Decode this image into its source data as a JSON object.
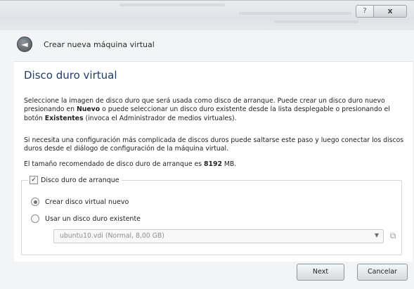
{
  "window": {
    "help_glyph": "?",
    "close_glyph": "x"
  },
  "header": {
    "back_glyph": "◄",
    "title": "Crear nueva máquina virtual"
  },
  "main": {
    "section_title": "Disco duro virtual",
    "p1": {
      "a": "Seleccione la imagen de disco duro que será usada como disco de arranque. Puede crear un disco duro nuevo presionando en ",
      "b1": "Nuevo",
      "c": " o puede seleccionar un disco duro existente desde la lista desplegable o presionando el botón ",
      "b2": "Existentes",
      "d": " (invoca el Administrador de medios virtuales)."
    },
    "p2": "Si necesita una configuración más complicada de discos duros puede saltarse este paso y luego conectar los discos duros desde el diálogo de configuración de la máquina virtual.",
    "p3": {
      "a": "El tamaño recomendado de disco duro de arranque es ",
      "size": "8192",
      "unit": " MB."
    },
    "group": {
      "label": "Disco duro de arranque",
      "checked_glyph": "✓",
      "radio_new": "Crear disco virtual nuevo",
      "radio_existing": "Usar un disco duro existente",
      "selected_disk": "ubuntu10.vdi (Normal, 8,00 GB)",
      "dropdown_glyph": "▼",
      "folder_glyph": "⧉"
    }
  },
  "footer": {
    "next_label": "Next",
    "cancel_label": "Cancelar"
  }
}
